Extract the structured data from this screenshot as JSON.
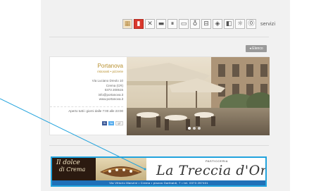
{
  "services": {
    "label": "servizi",
    "icons": [
      {
        "name": "photo-icon",
        "glyph": "▦",
        "style": "img"
      },
      {
        "name": "card-icon",
        "glyph": "▮",
        "style": "red"
      },
      {
        "name": "wheelchair-icon",
        "glyph": "✕",
        "style": ""
      },
      {
        "name": "bag-icon",
        "glyph": "▬",
        "style": ""
      },
      {
        "name": "restroom-icon",
        "glyph": "⏸",
        "style": ""
      },
      {
        "name": "menu-icon",
        "glyph": "▭",
        "style": ""
      },
      {
        "name": "bike-icon",
        "glyph": "♁",
        "style": ""
      },
      {
        "name": "parking-icon",
        "glyph": "⊟",
        "style": ""
      },
      {
        "name": "wifi-icon",
        "glyph": "◈",
        "style": ""
      },
      {
        "name": "pet-icon",
        "glyph": "◧",
        "style": ""
      },
      {
        "name": "sun-icon",
        "glyph": "☼",
        "style": ""
      },
      {
        "name": "info-icon",
        "glyph": "⓪",
        "style": ""
      }
    ]
  },
  "back_label": "◂ Elenco",
  "shop": {
    "name": "Portanova",
    "category": "ristoranti • pizzerie",
    "address_lines": [
      "Via Luciano Dreolo 10",
      "Crema (CR)",
      "0373 200515",
      "info@portanova.it",
      "www.portanova.it"
    ],
    "hours": "Aperto tutti i giorni dalle 7:00 alle 23:00",
    "social": [
      "fb",
      "tw",
      "g+"
    ]
  },
  "banner": {
    "left_line1": "Il dolce",
    "left_line2": "di Crema",
    "top": "PASTICCERIA",
    "title": "La Treccia d'Oro",
    "bottom": "Via Vittorio Manzini • Crema • piazza Garibaldi, 7 • tel. 0373 257401"
  }
}
